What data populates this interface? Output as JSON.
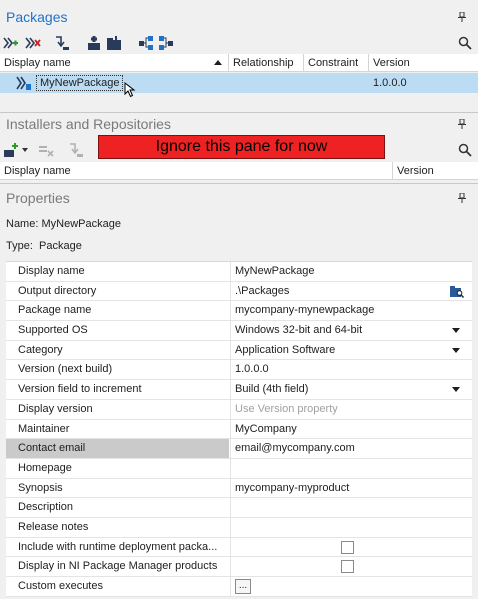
{
  "packages": {
    "title": "Packages",
    "columns": [
      "Display name",
      "Relationship",
      "Constraint",
      "Version"
    ],
    "rows": [
      {
        "name": "MyNewPackage",
        "relationship": "",
        "constraint": "",
        "version": "1.0.0.0"
      }
    ]
  },
  "installers": {
    "title": "Installers and Repositories",
    "banner": "Ignore this pane for now",
    "columns": [
      "Display name",
      "Version"
    ]
  },
  "properties": {
    "title": "Properties",
    "name_label": "Name:",
    "name_value": "MyNewPackage",
    "type_label": "Type:",
    "type_value": "Package",
    "rows": [
      {
        "name": "Display name",
        "value": "MyNewPackage"
      },
      {
        "name": "Output directory",
        "value": ".\\Packages"
      },
      {
        "name": "Package name",
        "value": "mycompany-mynewpackage"
      },
      {
        "name": "Supported OS",
        "value": "Windows 32-bit and 64-bit"
      },
      {
        "name": "Category",
        "value": "Application Software"
      },
      {
        "name": "Version (next build)",
        "value": "1.0.0.0"
      },
      {
        "name": "Version field to increment",
        "value": "Build (4th field)"
      },
      {
        "name": "Display version",
        "value": "Use Version property"
      },
      {
        "name": "Maintainer",
        "value": "MyCompany"
      },
      {
        "name": "Contact email",
        "value": "email@mycompany.com"
      },
      {
        "name": "Homepage",
        "value": ""
      },
      {
        "name": "Synopsis",
        "value": "mycompany-myproduct"
      },
      {
        "name": "Description",
        "value": ""
      },
      {
        "name": "Release notes",
        "value": ""
      },
      {
        "name": "Include with runtime deployment packa...",
        "value": ""
      },
      {
        "name": "Display in NI Package Manager products",
        "value": ""
      },
      {
        "name": "Custom executes",
        "value": "..."
      }
    ]
  },
  "colors": {
    "accent": "#1e72c8",
    "selection": "#bcdcf4",
    "banner_bg": "#ee2222"
  }
}
